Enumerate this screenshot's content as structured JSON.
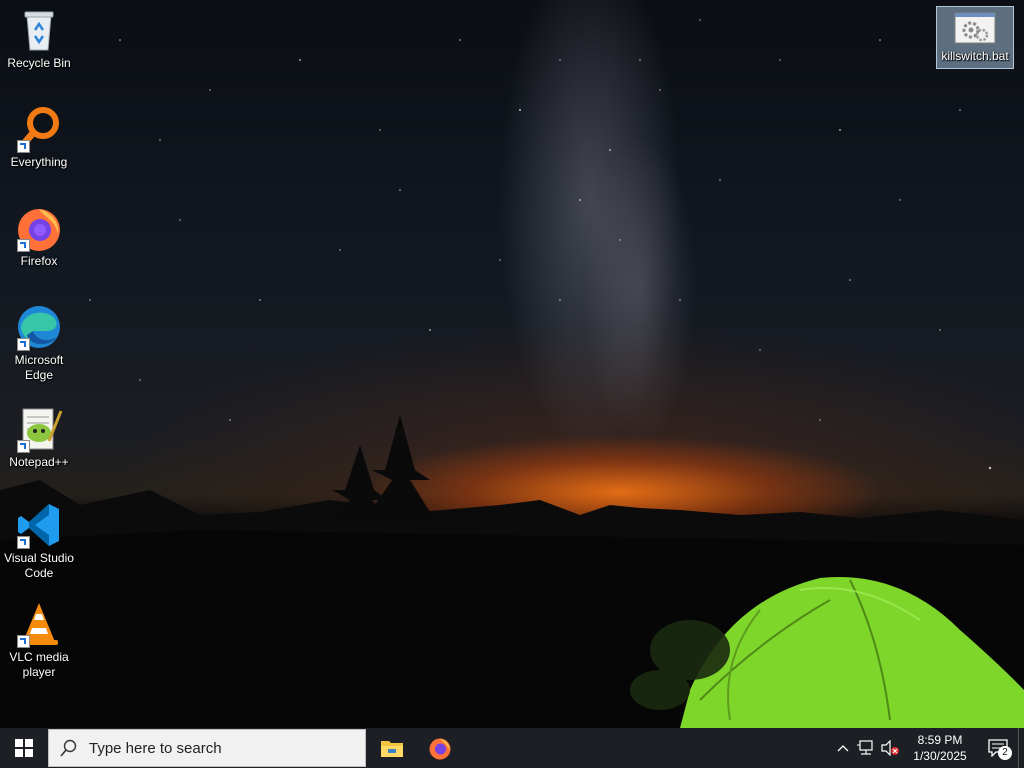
{
  "desktop": {
    "icons": [
      {
        "label": "Recycle Bin",
        "icon": "recycle-bin-icon"
      },
      {
        "label": "Everything",
        "icon": "everything-search-icon"
      },
      {
        "label": "Firefox",
        "icon": "firefox-icon"
      },
      {
        "label": "Microsoft Edge",
        "icon": "edge-icon"
      },
      {
        "label": "Notepad++",
        "icon": "notepad-plus-plus-icon"
      },
      {
        "label": "Visual Studio Code",
        "icon": "vscode-icon"
      },
      {
        "label": "VLC media player",
        "icon": "vlc-icon"
      },
      {
        "label": "killswitch.bat",
        "icon": "batch-file-icon",
        "selected": true
      }
    ]
  },
  "taskbar": {
    "start_icon": "windows-logo-icon",
    "search_placeholder": "Type here to search",
    "pinned": [
      {
        "name": "File Explorer",
        "icon": "folder-icon"
      },
      {
        "name": "Firefox",
        "icon": "firefox-icon"
      }
    ],
    "tray": {
      "time": "8:59 PM",
      "date": "1/30/2025",
      "notification_count": "2"
    }
  },
  "colors": {
    "taskbar_bg": "#1c1f24",
    "selection": "#a0bed7",
    "tent_green": "#7fd62a",
    "horizon_glow": "#ff7a14"
  }
}
